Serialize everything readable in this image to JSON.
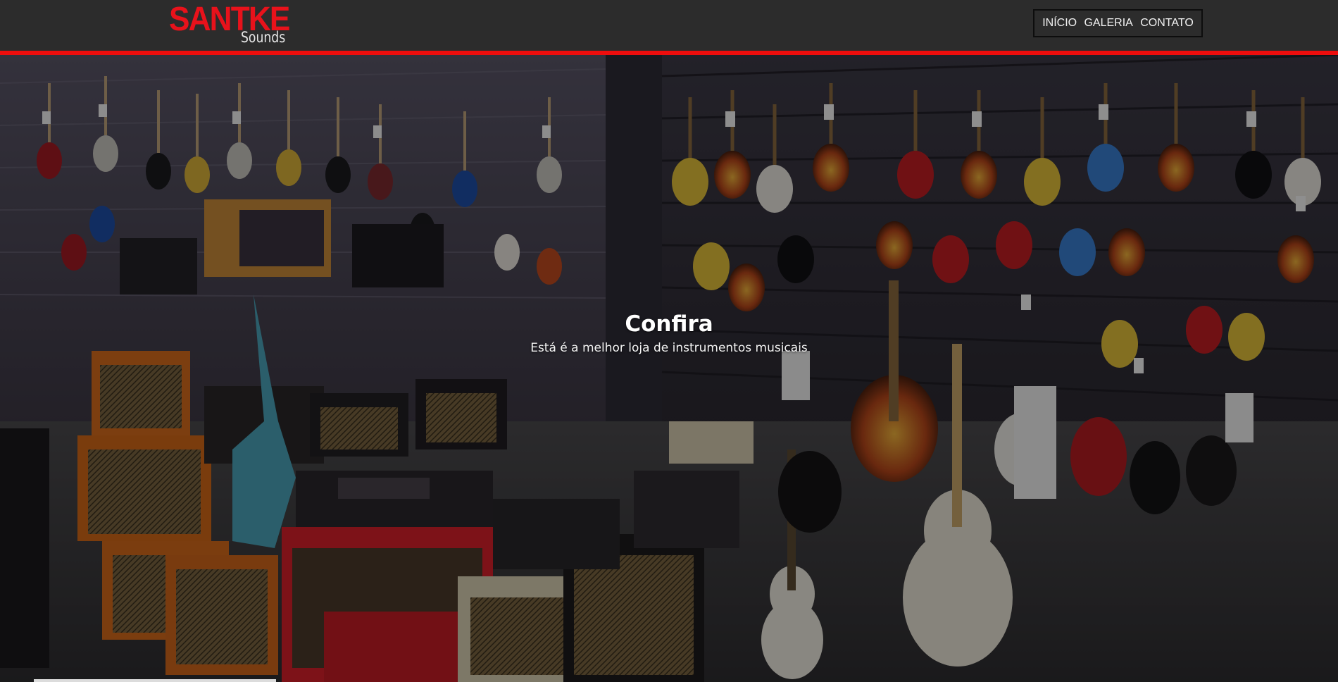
{
  "brand": {
    "logo_main": "SANTKE",
    "logo_sub": "Sounds",
    "colors": {
      "accent": "#ee0d0d",
      "header_bg": "#2c2c2c",
      "logo_red": "#e8121b"
    }
  },
  "nav": {
    "items": [
      {
        "label": "INÍCIO"
      },
      {
        "label": "GALERIA"
      },
      {
        "label": "CONTATO"
      }
    ]
  },
  "hero": {
    "title": "Confira",
    "subtitle": "Está é a melhor loja de instrumentos musicais"
  }
}
